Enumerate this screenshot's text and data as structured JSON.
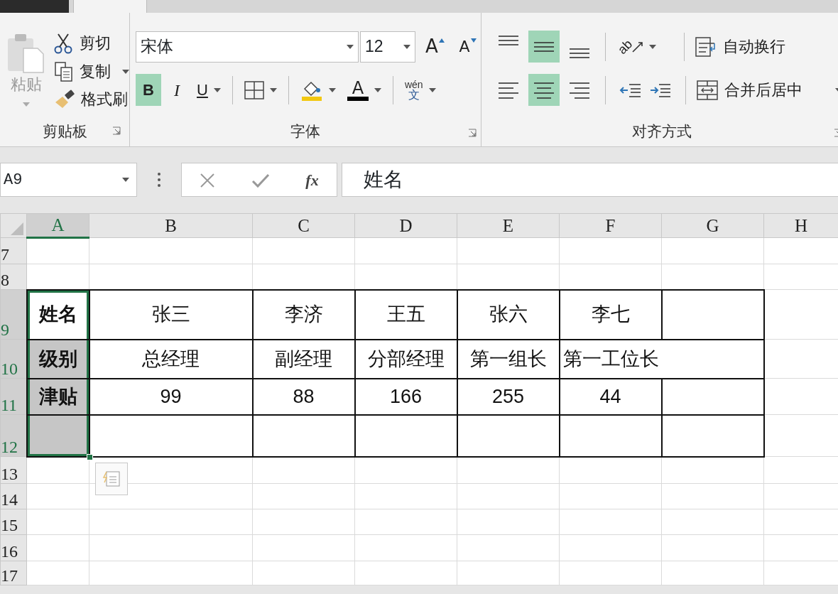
{
  "ribbon_tabs": [
    {
      "kind": "file",
      "selected": false
    },
    {
      "kind": "tab",
      "selected": true
    }
  ],
  "clipboard": {
    "paste": {
      "label": "粘贴",
      "disabled": true
    },
    "items": [
      {
        "kind": "cut",
        "label": "剪切",
        "dropdown": false
      },
      {
        "kind": "copy",
        "label": "复制",
        "dropdown": true
      },
      {
        "kind": "format_painter",
        "label": "格式刷",
        "dropdown": false
      }
    ],
    "group_label": "剪贴板"
  },
  "font": {
    "name": "宋体",
    "size": "12",
    "size_tools": [
      {
        "kind": "grow",
        "label": "A"
      },
      {
        "kind": "shrink",
        "label": "A"
      }
    ],
    "tools": [
      {
        "kind": "bold",
        "label": "B",
        "selected": true,
        "dropdown": false
      },
      {
        "kind": "italic",
        "label": "I",
        "selected": false,
        "dropdown": false
      },
      {
        "kind": "underline",
        "label": "U",
        "selected": false,
        "dropdown": true
      },
      {
        "kind": "borders",
        "selected": false,
        "dropdown": true
      },
      {
        "kind": "fill",
        "color": "#f2c811",
        "selected": false,
        "dropdown": true
      },
      {
        "kind": "font_color",
        "label": "A",
        "color": "#000000",
        "selected": false,
        "dropdown": true
      },
      {
        "kind": "phonetic",
        "pinyin": "wén",
        "char": "文",
        "selected": false,
        "dropdown": true
      }
    ],
    "group_label": "字体"
  },
  "alignment": {
    "vertical": [
      {
        "kind": "top",
        "selected": false
      },
      {
        "kind": "middle",
        "selected": true
      },
      {
        "kind": "bottom",
        "selected": false
      }
    ],
    "horizontal": [
      {
        "kind": "left",
        "selected": false
      },
      {
        "kind": "center",
        "selected": true
      },
      {
        "kind": "right",
        "selected": false
      }
    ],
    "orientation": {
      "label": "ab",
      "dropdown": true
    },
    "indent": [
      {
        "kind": "decrease"
      },
      {
        "kind": "increase"
      }
    ],
    "wrap_text": {
      "label": "自动换行"
    },
    "merge": {
      "label": "合并后居中",
      "dropdown": true
    },
    "group_label": "对齐方式"
  },
  "formula_bar": {
    "name_box": "A9",
    "function_label": "fx",
    "formula": "姓名"
  },
  "sheet": {
    "columns": [
      {
        "label": "A",
        "selected": true,
        "bordered": true
      },
      {
        "label": "B",
        "selected": false,
        "bordered": true
      },
      {
        "label": "C",
        "selected": false,
        "bordered": true
      },
      {
        "label": "D",
        "selected": false,
        "bordered": true
      },
      {
        "label": "E",
        "selected": false,
        "bordered": true
      },
      {
        "label": "F",
        "selected": false,
        "bordered": true
      },
      {
        "label": "G",
        "selected": false,
        "bordered": true
      },
      {
        "label": "H",
        "selected": false,
        "bordered": false
      }
    ],
    "rows": [
      {
        "label": "7",
        "selected": false,
        "bordered": false
      },
      {
        "label": "8",
        "selected": false,
        "bordered": false
      },
      {
        "label": "9",
        "selected": true,
        "bordered": true,
        "cells": [
          {
            "value": "姓名",
            "bold": true
          },
          {
            "value": "张三",
            "bold": false
          },
          {
            "value": "李济",
            "bold": false
          },
          {
            "value": "王五",
            "bold": false
          },
          {
            "value": "张六",
            "bold": false
          },
          {
            "value": "李七",
            "bold": false
          }
        ]
      },
      {
        "label": "10",
        "selected": true,
        "bordered": true,
        "cells": [
          {
            "value": "级别",
            "bold": true
          },
          {
            "value": "总经理",
            "bold": false
          },
          {
            "value": "副经理",
            "bold": false
          },
          {
            "value": "分部经理",
            "bold": false
          },
          {
            "value": "第一组长",
            "bold": false
          },
          {
            "value": "第一工位长",
            "bold": false,
            "overflow": true
          }
        ]
      },
      {
        "label": "11",
        "selected": true,
        "bordered": true,
        "cells": [
          {
            "value": "津贴",
            "bold": true
          },
          {
            "value": "99",
            "bold": false
          },
          {
            "value": "88",
            "bold": false
          },
          {
            "value": "166",
            "bold": false
          },
          {
            "value": "255",
            "bold": false
          },
          {
            "value": "44",
            "bold": false
          }
        ]
      },
      {
        "label": "12",
        "selected": true,
        "bordered": true
      },
      {
        "label": "13",
        "selected": false,
        "bordered": false
      },
      {
        "label": "14",
        "selected": false,
        "bordered": false
      },
      {
        "label": "15",
        "selected": false,
        "bordered": false
      },
      {
        "label": "16",
        "selected": false,
        "bordered": false
      },
      {
        "label": "17",
        "selected": false,
        "bordered": false
      }
    ],
    "quick_analysis": true
  }
}
